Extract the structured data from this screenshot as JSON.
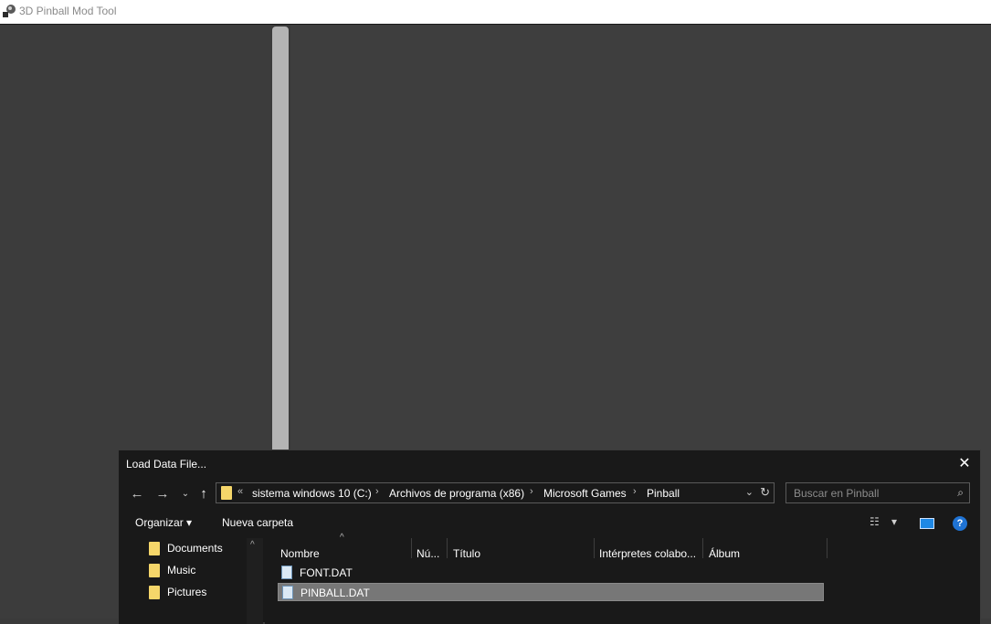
{
  "app": {
    "title": "3D Pinball Mod Tool"
  },
  "dialog": {
    "title": "Load Data File...",
    "address": {
      "overflow": "«",
      "crumbs": [
        "sistema windows 10 (C:)",
        "Archivos de programa (x86)",
        "Microsoft Games",
        "Pinball"
      ]
    },
    "search_placeholder": "Buscar en Pinball",
    "toolbar": {
      "organize": "Organizar",
      "new_folder": "Nueva carpeta"
    },
    "nav_items": [
      {
        "label": "Documents"
      },
      {
        "label": "Music"
      },
      {
        "label": "Pictures"
      }
    ],
    "columns": [
      "Nombre",
      "Nú...",
      "Título",
      "Intérpretes colabo...",
      "Álbum"
    ],
    "files": [
      {
        "name": "FONT.DAT",
        "selected": false
      },
      {
        "name": "PINBALL.DAT",
        "selected": true
      }
    ]
  }
}
